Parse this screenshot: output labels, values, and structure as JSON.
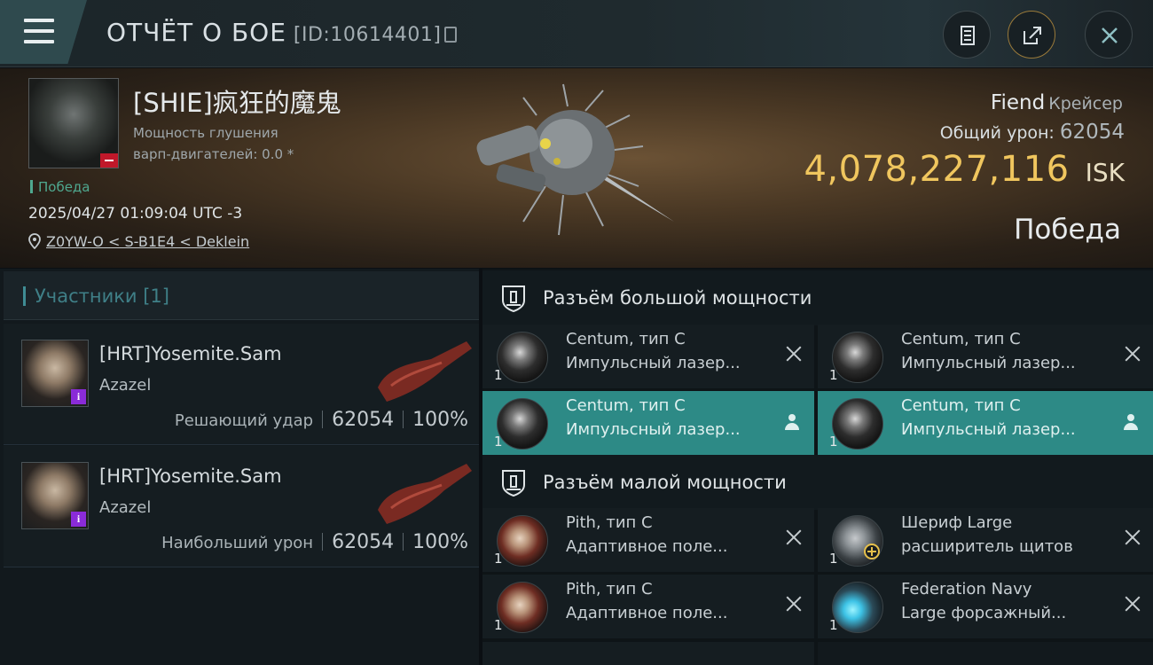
{
  "header": {
    "title": "ОТЧЁТ О БОЕ",
    "report_id": "[ID:10614401]"
  },
  "victim": {
    "name": "[SHIE]疯狂的魔鬼",
    "warp_line1": "Мощность глушения",
    "warp_line2": "варп-двигателей: 0.0 *",
    "status_tag": "Победа",
    "datetime": "2025/04/27 01:09:04 UTC -3",
    "location": "Z0YW-O < S-B1E4 < Deklein",
    "ship_name": "Fiend",
    "ship_class": "Крейсер",
    "damage_label": "Общий урон:",
    "damage_value": "62054",
    "isk_value": "4,078,227,116",
    "isk_unit": "ISK",
    "result": "Победа"
  },
  "participants": {
    "header": "Участники [1]",
    "items": [
      {
        "name": "[HRT]Yosemite.Sam",
        "ship": "Azazel",
        "role": "Решающий удар",
        "damage": "62054",
        "percent": "100%"
      },
      {
        "name": "[HRT]Yosemite.Sam",
        "ship": "Azazel",
        "role": "Наибольший урон",
        "damage": "62054",
        "percent": "100%"
      }
    ]
  },
  "sections": {
    "high": {
      "title": "Разъём большой мощности",
      "modules": [
        {
          "name": "Centum, тип C",
          "desc": "Импульсный лазер...",
          "qty": "1",
          "state": "destroyed"
        },
        {
          "name": "Centum, тип C",
          "desc": "Импульсный лазер...",
          "qty": "1",
          "state": "destroyed"
        },
        {
          "name": "Centum, тип C",
          "desc": "Импульсный лазер...",
          "qty": "1",
          "state": "dropped"
        },
        {
          "name": "Centum, тип C",
          "desc": "Импульсный лазер...",
          "qty": "1",
          "state": "dropped"
        }
      ]
    },
    "mid": {
      "title": "Разъём малой мощности",
      "modules": [
        {
          "name": "Pith, тип C",
          "desc": "Адаптивное поле...",
          "qty": "1",
          "state": "destroyed"
        },
        {
          "name": "Шериф Large",
          "desc": "расширитель щитов",
          "qty": "1",
          "state": "destroyed"
        },
        {
          "name": "Pith, тип C",
          "desc": "Адаптивное поле...",
          "qty": "1",
          "state": "destroyed"
        },
        {
          "name": "Federation Navy",
          "desc": "Large форсажный...",
          "qty": "1",
          "state": "destroyed"
        }
      ]
    }
  },
  "icons": {
    "menu": "hamburger-menu-icon",
    "copy": "copy-icon",
    "bookmark": "document-icon",
    "share": "share-icon",
    "close": "close-icon",
    "location": "map-pin-icon"
  },
  "colors": {
    "accent_teal": "#2d8a86",
    "isk_gold": "#f0c65e",
    "victory_green": "#4fa88f"
  }
}
